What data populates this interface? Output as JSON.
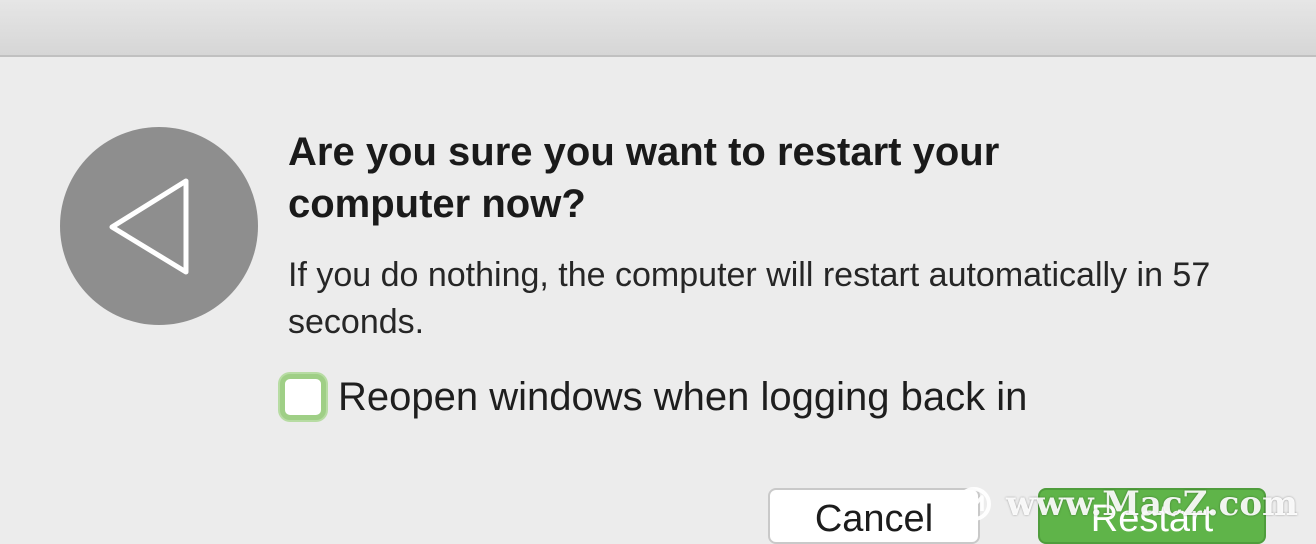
{
  "dialog": {
    "icon": "restart-triangle-icon",
    "title": "Are you sure you want to restart your computer now?",
    "message": "If you do nothing, the computer will restart automatically in 57 seconds.",
    "countdown_seconds": 57,
    "checkbox": {
      "label": "Reopen windows when logging back in",
      "checked": false
    },
    "buttons": {
      "cancel": "Cancel",
      "restart": "Restart"
    }
  },
  "watermark": {
    "text": "www.MacZ.com",
    "icon": "m-logo-icon"
  },
  "colors": {
    "background": "#ececec",
    "icon_circle": "#8e8e8e",
    "accent_green": "#5fb449",
    "checkbox_focus": "#9fcf86"
  }
}
